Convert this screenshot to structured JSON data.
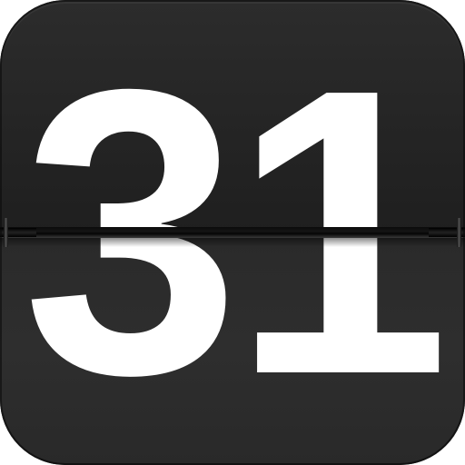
{
  "flip_clock": {
    "value": "31"
  },
  "colors": {
    "card_top": "#242424",
    "card_bottom": "#2e2e2e",
    "digit": "#ffffff",
    "hinge": "#0b0b0b"
  }
}
